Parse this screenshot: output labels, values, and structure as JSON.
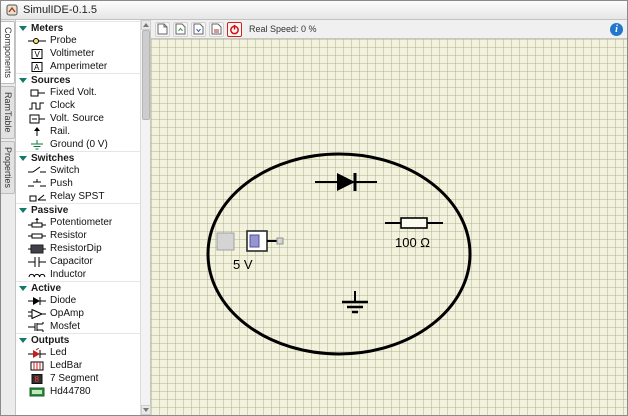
{
  "window": {
    "title": "SimulIDE-0.1.5"
  },
  "side_tabs": [
    {
      "label": "Components"
    },
    {
      "label": "RamTable"
    },
    {
      "label": "Properties"
    }
  ],
  "sidebar": {
    "categories": [
      {
        "label": "Meters",
        "items": [
          {
            "label": "Probe",
            "icon": "probe-icon"
          },
          {
            "label": "Voltimeter",
            "icon": "voltmeter-icon"
          },
          {
            "label": "Amperimeter",
            "icon": "ammeter-icon"
          }
        ]
      },
      {
        "label": "Sources",
        "items": [
          {
            "label": "Fixed Volt.",
            "icon": "fixed-volt-icon"
          },
          {
            "label": "Clock",
            "icon": "clock-icon"
          },
          {
            "label": "Volt. Source",
            "icon": "volt-source-icon"
          },
          {
            "label": "Rail.",
            "icon": "rail-icon"
          },
          {
            "label": "Ground (0 V)",
            "icon": "ground-icon"
          }
        ]
      },
      {
        "label": "Switches",
        "items": [
          {
            "label": "Switch",
            "icon": "switch-icon"
          },
          {
            "label": "Push",
            "icon": "push-icon"
          },
          {
            "label": "Relay SPST",
            "icon": "relay-icon"
          }
        ]
      },
      {
        "label": "Passive",
        "items": [
          {
            "label": "Potentiometer",
            "icon": "potentiometer-icon"
          },
          {
            "label": "Resistor",
            "icon": "resistor-icon"
          },
          {
            "label": "ResistorDip",
            "icon": "resistordip-icon"
          },
          {
            "label": "Capacitor",
            "icon": "capacitor-icon"
          },
          {
            "label": "Inductor",
            "icon": "inductor-icon"
          }
        ]
      },
      {
        "label": "Active",
        "items": [
          {
            "label": "Diode",
            "icon": "diode-icon"
          },
          {
            "label": "OpAmp",
            "icon": "opamp-icon"
          },
          {
            "label": "Mosfet",
            "icon": "mosfet-icon"
          }
        ]
      },
      {
        "label": "Outputs",
        "items": [
          {
            "label": "Led",
            "icon": "led-icon"
          },
          {
            "label": "LedBar",
            "icon": "ledbar-icon"
          },
          {
            "label": "7 Segment",
            "icon": "seven-segment-icon"
          },
          {
            "label": "Hd44780",
            "icon": "hd44780-icon"
          }
        ]
      }
    ]
  },
  "toolbar": {
    "real_speed_label": "Real Speed: 0 %",
    "info_label": "i"
  },
  "canvas": {
    "voltage_source_label": "5 V",
    "resistor_label": "100 Ω"
  }
}
